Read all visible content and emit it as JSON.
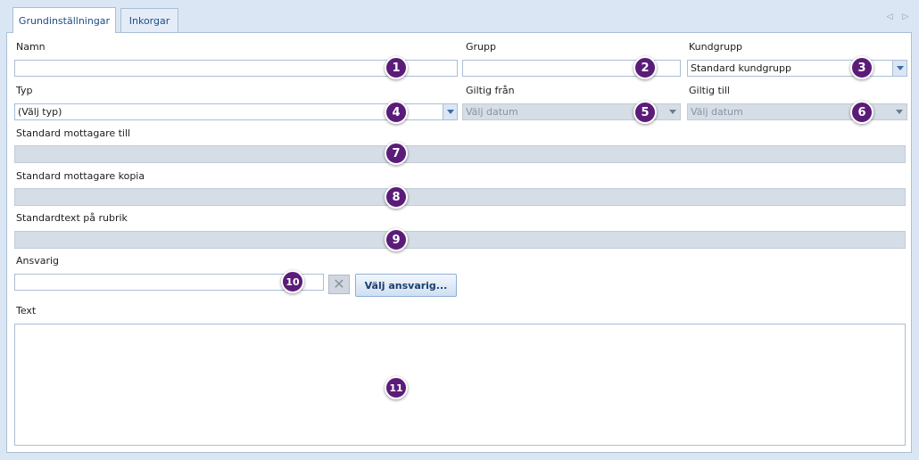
{
  "tabs": [
    {
      "label": "Grundinställningar",
      "active": true
    },
    {
      "label": "Inkorgar",
      "active": false
    }
  ],
  "form": {
    "name": {
      "label": "Namn",
      "value": ""
    },
    "group": {
      "label": "Grupp",
      "value": ""
    },
    "customer_group": {
      "label": "Kundgrupp",
      "value": "Standard kundgrupp"
    },
    "type": {
      "label": "Typ",
      "value": "(Välj typ)"
    },
    "valid_from": {
      "label": "Giltig från",
      "value": "Välj datum"
    },
    "valid_to": {
      "label": "Giltig till",
      "value": "Välj datum"
    },
    "default_recipient_to": {
      "label": "Standard mottagare till",
      "value": ""
    },
    "default_recipient_copy": {
      "label": "Standard mottagare kopia",
      "value": ""
    },
    "default_subject_text": {
      "label": "Standardtext på rubrik",
      "value": ""
    },
    "responsible": {
      "label": "Ansvarig",
      "value": "",
      "choose_label": "Välj ansvarig..."
    },
    "text": {
      "label": "Text",
      "value": ""
    }
  },
  "badges": [
    "1",
    "2",
    "3",
    "4",
    "5",
    "6",
    "7",
    "8",
    "9",
    "10",
    "11"
  ],
  "icons": {
    "nav_left": "chevron-left-icon",
    "nav_right": "chevron-right-icon",
    "clear": "close-icon",
    "dropdown": "chevron-down-icon"
  },
  "colors": {
    "badge": "#5b1c79",
    "disabled_field": "#d5dde6",
    "border": "#a9bfd6",
    "background": "#dbe6f4"
  }
}
